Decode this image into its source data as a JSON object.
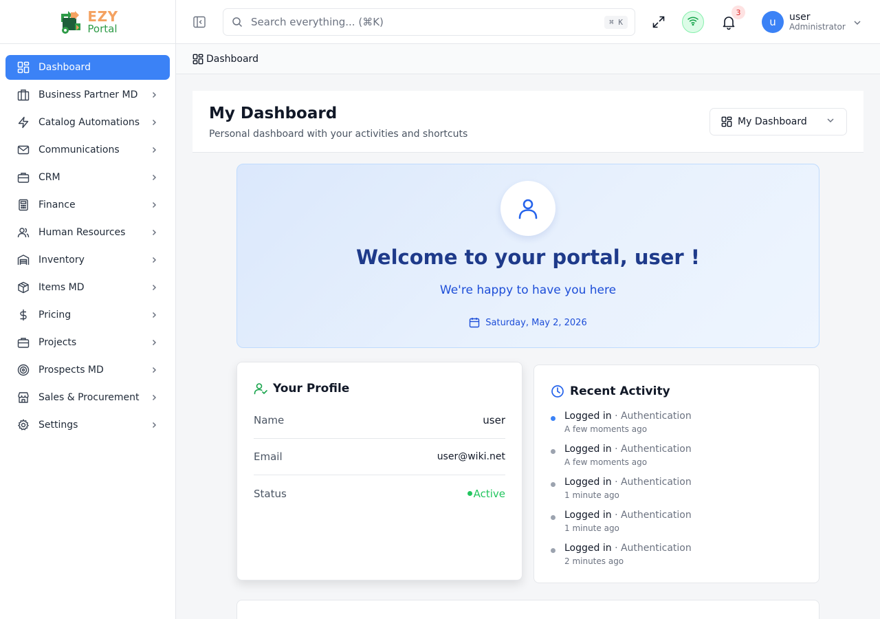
{
  "brand": {
    "name_top": "EZY",
    "name_bottom": "Portal"
  },
  "sidebar": {
    "items": [
      {
        "label": "Dashboard",
        "icon": "dashboard-icon",
        "active": true
      },
      {
        "label": "Business Partner MD",
        "icon": "building-icon"
      },
      {
        "label": "Catalog Automations",
        "icon": "lightning-icon"
      },
      {
        "label": "Communications",
        "icon": "mail-icon"
      },
      {
        "label": "CRM",
        "icon": "briefcase-icon"
      },
      {
        "label": "Finance",
        "icon": "calculator-icon"
      },
      {
        "label": "Human Resources",
        "icon": "users-icon"
      },
      {
        "label": "Inventory",
        "icon": "warehouse-icon"
      },
      {
        "label": "Items MD",
        "icon": "package-icon"
      },
      {
        "label": "Pricing",
        "icon": "dollar-icon"
      },
      {
        "label": "Projects",
        "icon": "briefcase-icon"
      },
      {
        "label": "Prospects MD",
        "icon": "target-icon"
      },
      {
        "label": "Sales & Procurement",
        "icon": "store-icon"
      },
      {
        "label": "Settings",
        "icon": "gear-icon"
      }
    ]
  },
  "topbar": {
    "search_placeholder": "Search everything... (⌘K)",
    "search_shortcut": "⌘ K",
    "notification_count": "3",
    "user": {
      "initial": "u",
      "name": "user",
      "role": "Administrator"
    }
  },
  "breadcrumb": {
    "current": "Dashboard"
  },
  "page": {
    "title": "My Dashboard",
    "subtitle": "Personal dashboard with your activities and shortcuts",
    "dashboard_select": "My Dashboard"
  },
  "welcome": {
    "title": "Welcome to your portal, user !",
    "subtitle": "We're happy to have you here",
    "date": "Saturday, May 2, 2026"
  },
  "profile": {
    "title": "Your Profile",
    "rows": [
      {
        "label": "Name",
        "value": "user"
      },
      {
        "label": "Email",
        "value": "user@wiki.net"
      },
      {
        "label": "Status",
        "value": "Active"
      }
    ]
  },
  "activity": {
    "title": "Recent Activity",
    "items": [
      {
        "action": "Logged in",
        "category": "· Authentication",
        "time": "A few moments ago"
      },
      {
        "action": "Logged in",
        "category": "· Authentication",
        "time": "A few moments ago"
      },
      {
        "action": "Logged in",
        "category": "· Authentication",
        "time": "1 minute ago"
      },
      {
        "action": "Logged in",
        "category": "· Authentication",
        "time": "1 minute ago"
      },
      {
        "action": "Logged in",
        "category": "· Authentication",
        "time": "2 minutes ago"
      }
    ]
  },
  "colors": {
    "accent": "#3b82f6",
    "welcome_title": "#1e3a8a",
    "status_active": "#22c55e",
    "brand_orange": "#f4a261",
    "brand_green": "#2e9b47"
  }
}
